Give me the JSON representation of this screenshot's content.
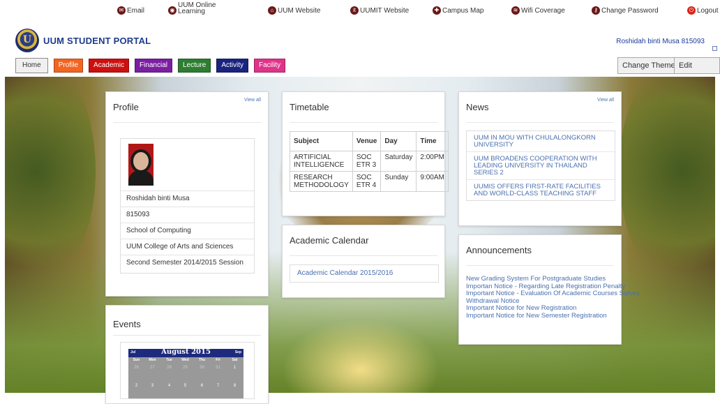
{
  "toplinks": [
    {
      "label": "Email",
      "icon": "email-icon"
    },
    {
      "label": "UUM Online Learning",
      "line1": "UUM Online",
      "line2": "Learning",
      "icon": "learning-icon"
    },
    {
      "label": "UUM Website",
      "icon": "website-icon"
    },
    {
      "label": "UUMIT Website",
      "icon": "uumit-icon"
    },
    {
      "label": "Campus Map",
      "icon": "map-icon"
    },
    {
      "label": "Wifi Coverage",
      "icon": "wifi-icon"
    },
    {
      "label": "Change Password",
      "icon": "key-icon"
    },
    {
      "label": "Logout",
      "icon": "power-icon"
    }
  ],
  "brand": {
    "name": "UUM STUDENT PORTAL"
  },
  "user": {
    "name": "Roshidah binti Musa 815093"
  },
  "nav": [
    {
      "label": "Home",
      "color": "#f0f0f0"
    },
    {
      "label": "Profile",
      "color": "#f26522"
    },
    {
      "label": "Academic",
      "color": "#cc1010"
    },
    {
      "label": "Financial",
      "color": "#7b1fa2"
    },
    {
      "label": "Lecture",
      "color": "#2e7d32"
    },
    {
      "label": "Activity",
      "color": "#1a237e"
    },
    {
      "label": "Facility",
      "color": "#e0338a"
    }
  ],
  "buttons": {
    "change_theme": "Change Theme",
    "edit_layout": "Edit Layout"
  },
  "profile": {
    "title": "Profile",
    "view_all": "View all",
    "name": "Roshidah binti Musa",
    "id": "815093",
    "school": "School of Computing",
    "college": "UUM College of Arts and Sciences",
    "session": "Second Semester 2014/2015 Session"
  },
  "timetable": {
    "title": "Timetable",
    "headers": [
      "Subject",
      "Venue",
      "Day",
      "Time"
    ],
    "rows": [
      {
        "subject": "ARTIFICIAL INTELLIGENCE",
        "venue": "SOC ETR 3",
        "day": "Saturday",
        "time": "2:00PM"
      },
      {
        "subject": "RESEARCH METHODOLOGY",
        "venue": "SOC ETR 4",
        "day": "Sunday",
        "time": "9:00AM"
      }
    ]
  },
  "news": {
    "title": "News",
    "view_all": "View all",
    "items": [
      "UUM IN MOU WITH CHULALONGKORN UNIVERSITY",
      "UUM BROADENS COOPERATION WITH LEADING UNIVERSITY IN THAILAND SERIES 2",
      "UUMIS OFFERS FIRST-RATE FACILITIES AND WORLD-CLASS TEACHING STAFF"
    ]
  },
  "academic_calendar": {
    "title": "Academic Calendar",
    "link": "Academic Calendar 2015/2016"
  },
  "announcements": {
    "title": "Announcements",
    "items": [
      "New Grading System For Postgraduate Studies",
      "Importan Notice - Regarding Late Registration Penalty",
      "Important Notice - Evaluation Of Academic Courses Survey",
      "Withdrawal Notice",
      "Important Notice for New Registration",
      "Important Notice for New Semester Registration"
    ]
  },
  "events": {
    "title": "Events",
    "calendar": {
      "month": "August 2015",
      "prev": "Jul",
      "next": "Sep",
      "day_names": [
        "Sun",
        "Mon",
        "Tue",
        "Wed",
        "Thu",
        "Fri",
        "Sat"
      ],
      "week1": [
        "26",
        "27",
        "28",
        "29",
        "30",
        "31",
        "1"
      ],
      "week2": [
        "2",
        "3",
        "4",
        "5",
        "6",
        "7",
        "8"
      ]
    }
  }
}
